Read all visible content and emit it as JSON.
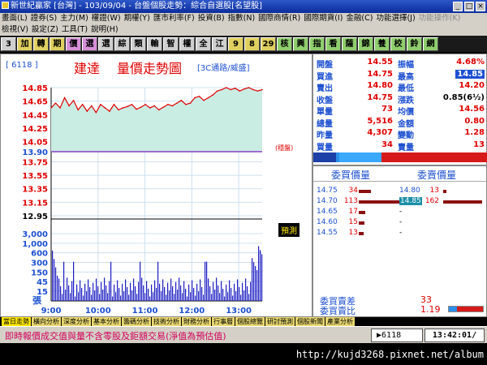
{
  "window": {
    "title": "新世紀贏家 [台灣] - 103/09/04 - 台盤個股走勢：綜合自選股[名望股]"
  },
  "menu": {
    "row1": [
      "畫面(L)",
      "證券(S)",
      "主力(M)",
      "權證(W)",
      "期權(Y)",
      "匯市利率(F)",
      "投資(B)",
      "指數(N)",
      "國際商情(R)",
      "國際期貨(I)",
      "金融(C)",
      "功能選擇(J)",
      "功能操作(K)"
    ],
    "row2": [
      "檢視(V)",
      "設定(Z)",
      "工具(T)",
      "說明(H)"
    ]
  },
  "funcbar": {
    "buttons": [
      "3",
      "加",
      "轉",
      "期",
      "價",
      "選",
      "選",
      "綜",
      "類",
      "輸",
      "智",
      "權",
      "全",
      "江",
      "9",
      "8",
      "29",
      "核",
      "興",
      "指",
      "看",
      "薩",
      "錦",
      "養",
      "校",
      "鈴",
      "網"
    ]
  },
  "chart": {
    "stock_code": "[ 6118 ]",
    "stock_name": "建達",
    "title": "量價走勢圖",
    "subtitle": "[3C通路/威盛]",
    "note": "(穩盤)",
    "button_label": "預測",
    "vol_axis_unit": "張",
    "price_ticks": [
      "14.85",
      "14.65",
      "14.45",
      "14.25",
      "14.05",
      "13.90",
      "13.75",
      "13.55",
      "13.35",
      "13.15",
      "12.95"
    ],
    "vol_ticks": [
      "3,000",
      "1,000",
      "600",
      "300",
      "150",
      "45",
      "15"
    ],
    "time_ticks": [
      "9:00",
      "10:00",
      "11:00",
      "12:00",
      "13:00"
    ]
  },
  "chart_data": {
    "type": "line",
    "title": "量價走勢圖",
    "series": [
      {
        "values": [
          14.55,
          14.62,
          14.55,
          14.7,
          14.58,
          14.66,
          14.52,
          14.6,
          14.5,
          14.58,
          14.48,
          14.6,
          14.55,
          14.5,
          14.6,
          14.52,
          14.55,
          14.57,
          14.6,
          14.53,
          14.56,
          14.6,
          14.55,
          14.58,
          14.52,
          14.56,
          14.6,
          14.58,
          14.62,
          14.66,
          14.6,
          14.62,
          14.7,
          14.72,
          14.66,
          14.7,
          14.74,
          14.8,
          14.82,
          14.85,
          14.82,
          14.84,
          14.8,
          14.83,
          14.85,
          14.82,
          14.8,
          14.82
        ]
      }
    ],
    "ylim": [
      12.95,
      14.85
    ],
    "volume_ylim": [
      0,
      3000
    ],
    "ref_price": 13.9,
    "x_start": "9:00",
    "x_end": "13:30"
  },
  "quote": {
    "left_labels": [
      "開盤",
      "買進",
      "賣出",
      "收盤",
      "單量",
      "總量",
      "昨量",
      "買量"
    ],
    "left_values": [
      "14.55",
      "14.75",
      "14.80",
      "14.75",
      "73",
      "5,516",
      "4,307",
      "34"
    ],
    "right_labels": [
      "振幅",
      "最高",
      "最低",
      "漲跌",
      "均價",
      "金額",
      "變動",
      "賣量"
    ],
    "right_values": [
      "4.68%",
      "14.85",
      "14.20",
      "0.85(6½)",
      "14.56",
      "0.80",
      "1.28",
      "13"
    ]
  },
  "orderbook": {
    "bid_header": "委買價量",
    "ask_header": "委賣價量",
    "bids": [
      [
        "14.75",
        "34"
      ],
      [
        "14.70",
        "113"
      ],
      [
        "14.65",
        "17"
      ],
      [
        "14.60",
        "15"
      ],
      [
        "14.55",
        "13"
      ]
    ],
    "asks": [
      [
        "14.80",
        "13"
      ],
      [
        "14.85",
        "162"
      ],
      [
        "-",
        ""
      ],
      [
        "-",
        ""
      ],
      [
        "-",
        ""
      ]
    ],
    "summary": [
      {
        "label": "委買賣差",
        "value": "33"
      },
      {
        "label": "委買賣比",
        "value": "1.19"
      }
    ]
  },
  "tabs": [
    "當日走勢",
    "橫向分析",
    "深度分析",
    "基本分析",
    "籌碼分析",
    "技術分析",
    "財務分析",
    "行事曆",
    "個股總覽",
    "研討預測",
    "個股新聞",
    "產業分析"
  ],
  "status": {
    "message": "即時報價成交值與量不含零股及鉅額交易(淨值為預估值)",
    "code": "6118",
    "time": "13:42:01/"
  },
  "watermark": "http://kujd3268.pixnet.net/album",
  "colors": {
    "up": "#e00000",
    "down": "#008000",
    "flat": "#000000",
    "accent_blue": "#1c4fd1"
  }
}
